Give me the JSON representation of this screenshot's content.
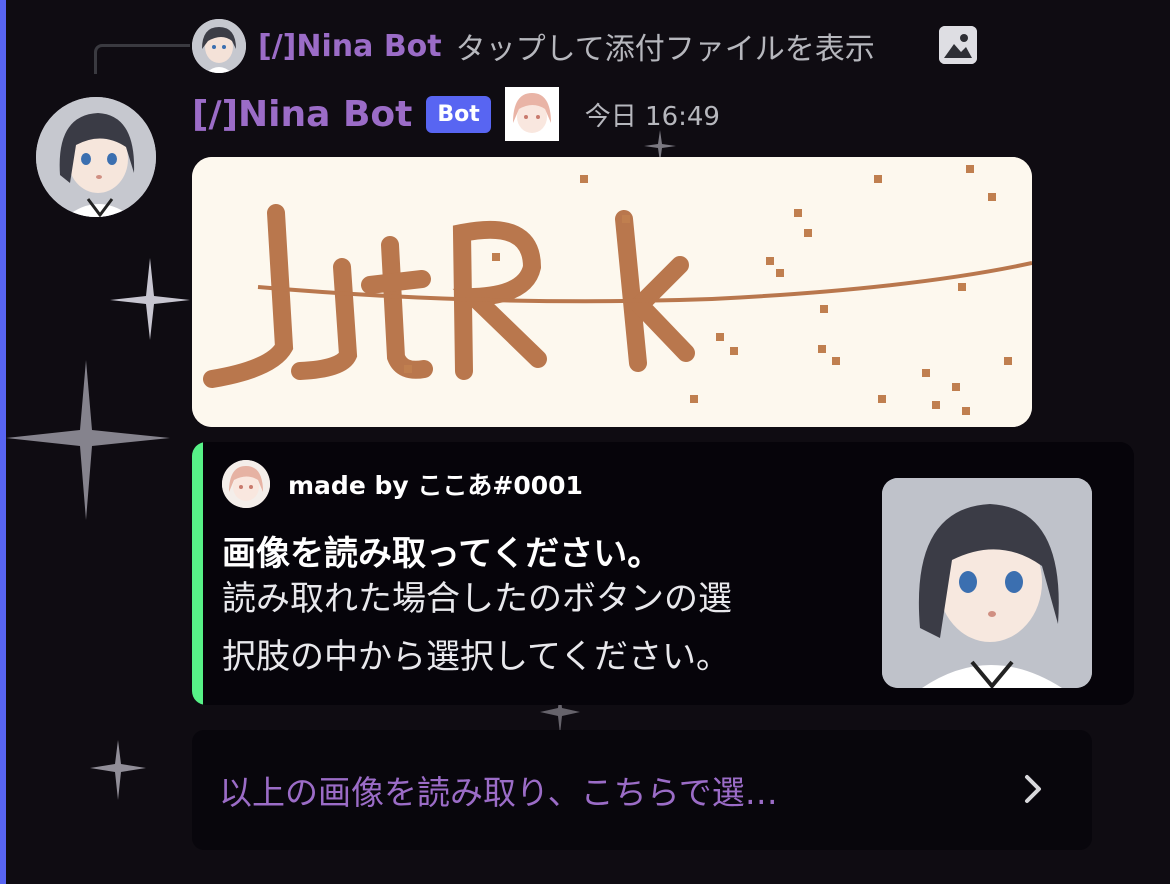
{
  "reply": {
    "author_name": "[/]Nina Bot",
    "preview_text": "タップして添付ファイルを表示",
    "attachment_icon": "image-icon"
  },
  "message": {
    "author_name": "[/]Nina Bot",
    "bot_tag": "Bot",
    "timestamp": "今日 16:49",
    "role_icon": "role-avatar-icon"
  },
  "captcha": {
    "text": "JjtRk"
  },
  "embed": {
    "accent_color": "#57f287",
    "author_name": "made by ここあ#0001",
    "title": "画像を読み取ってください。",
    "description_line1": "読み取れた場合したのボタンの選",
    "description_line2": "択肢の中から選択してください。"
  },
  "select_menu": {
    "placeholder": "以上の画像を読み取り、こちらで選…",
    "chevron_icon": "chevron-right-icon"
  },
  "colors": {
    "accent": "#5865f2",
    "author_color": "#9b6cc7",
    "background": "#0f0c12"
  }
}
